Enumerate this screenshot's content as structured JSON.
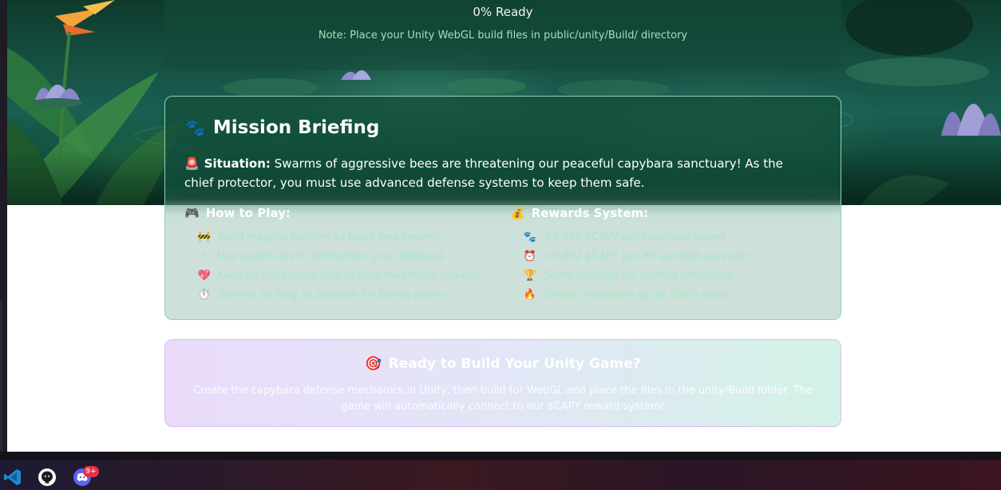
{
  "loading": {
    "progress_text": "0% Ready",
    "note": "Note: Place your Unity WebGL build files in public/unity/Build/ directory"
  },
  "mission": {
    "icon": "paw-prints-icon",
    "title": "Mission Briefing",
    "situation_icon": "siren-icon",
    "situation_label": "Situation:",
    "situation_text": "Swarms of aggressive bees are threatening our peaceful capybara sanctuary! As the chief protector, you must use advanced defense systems to keep them safe.",
    "how_to_play": {
      "icon": "game-controller-icon",
      "title": "How to Play:",
      "items": [
        {
          "emoji": "🚧",
          "text": "Build magical barriers to block bee swarms"
        },
        {
          "emoji": "⚡",
          "text": "Use power-ups to strengthen your defenses"
        },
        {
          "emoji": "💖",
          "text": "Keep all capybaras safe to earn maximum rewards"
        },
        {
          "emoji": "⏱️",
          "text": "Survive as long as possible for bonus points"
        }
      ]
    },
    "rewards": {
      "icon": "money-bag-icon",
      "title": "Rewards System:",
      "items": [
        {
          "emoji": "🐾",
          "text": "+0.005 $CAPY per capybara saved"
        },
        {
          "emoji": "⏰",
          "text": "+0.002 $CAPY per 30 seconds survived"
        },
        {
          "emoji": "🏆",
          "text": "Score bonuses for perfect protection"
        },
        {
          "emoji": "🔥",
          "text": "Streak multipliers up to 100% extra"
        }
      ]
    }
  },
  "cta": {
    "icon": "target-icon",
    "title": "Ready to Build Your Unity Game?",
    "body": "Create the capybara defense mechanics in Unity, then build for WebGL and place the files in the unity/Build folder. The game will automatically connect to our $CAPY reward system!"
  },
  "taskbar": {
    "apps": [
      "vscode-icon",
      "github-icon",
      "discord-icon"
    ],
    "discord_badge": "9+"
  },
  "colors": {
    "accent_green": "#a9e8c6",
    "card_border": "#8fd3b1",
    "badge_red": "#e5314a"
  }
}
